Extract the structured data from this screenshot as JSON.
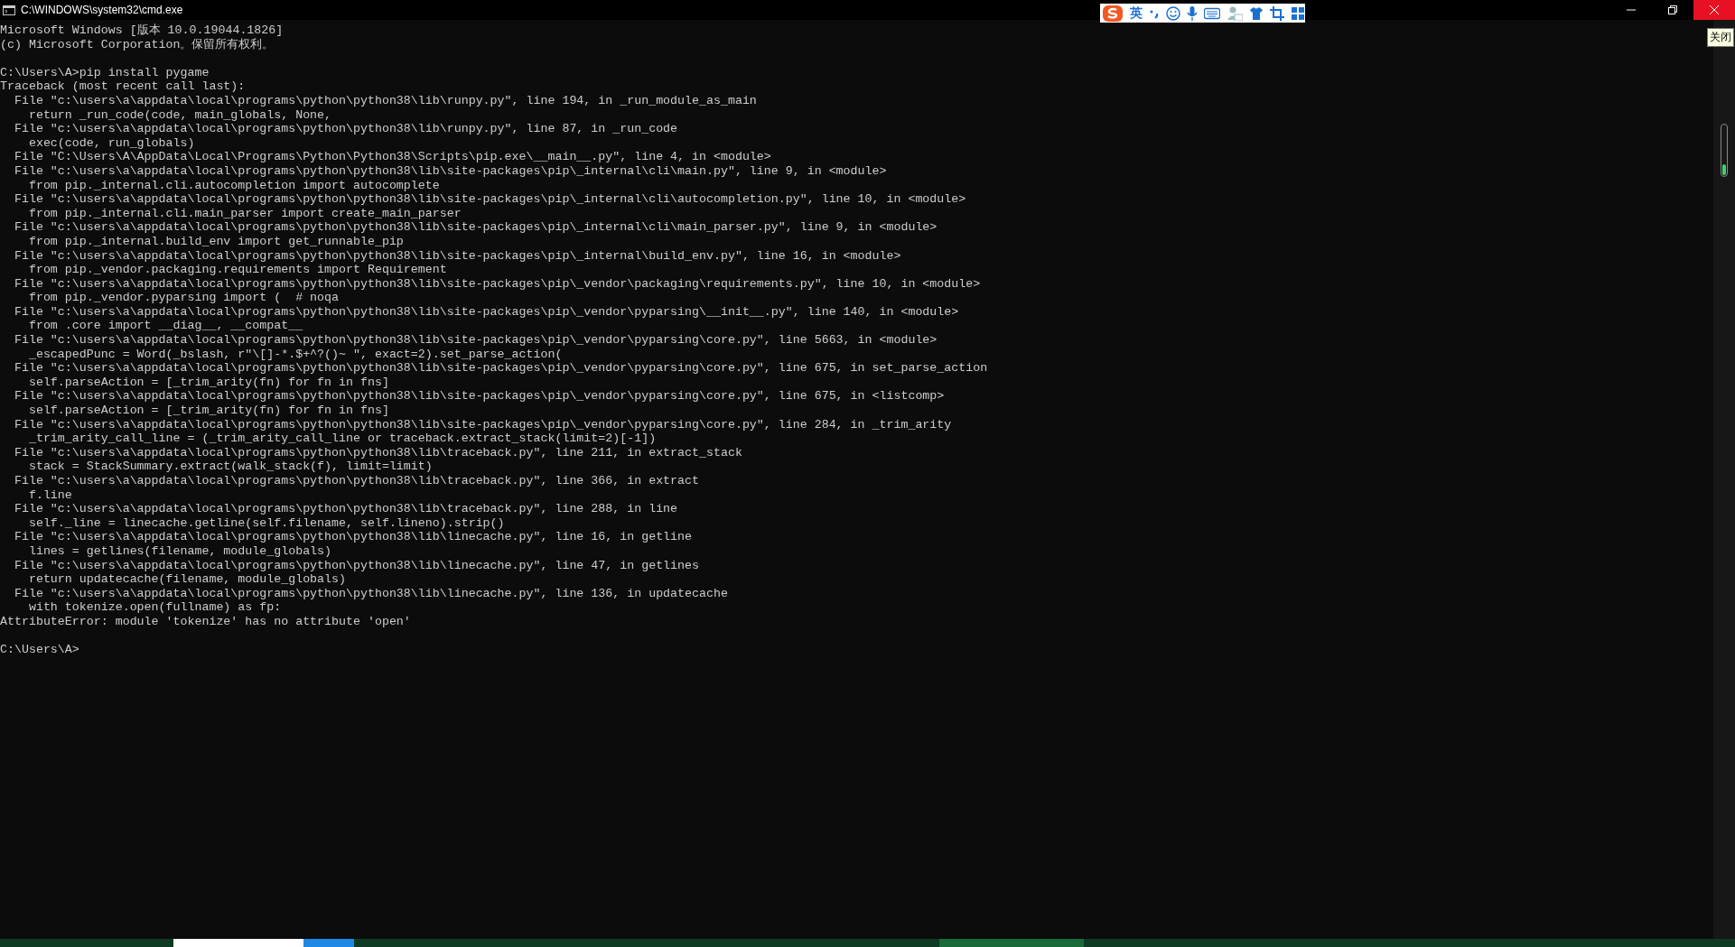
{
  "window": {
    "title": "C:\\WINDOWS\\system32\\cmd.exe"
  },
  "ime_toolbar": {
    "mode": "英"
  },
  "tooltip": "关闭",
  "console": {
    "blocks": [
      [
        "Microsoft Windows [版本 10.0.19044.1826]",
        "(c) Microsoft Corporation。保留所有权利。"
      ],
      [
        "C:\\Users\\A>pip install pygame",
        "Traceback (most recent call last):",
        "  File \"c:\\users\\a\\appdata\\local\\programs\\python\\python38\\lib\\runpy.py\", line 194, in _run_module_as_main",
        "    return _run_code(code, main_globals, None,",
        "  File \"c:\\users\\a\\appdata\\local\\programs\\python\\python38\\lib\\runpy.py\", line 87, in _run_code",
        "    exec(code, run_globals)",
        "  File \"C:\\Users\\A\\AppData\\Local\\Programs\\Python\\Python38\\Scripts\\pip.exe\\__main__.py\", line 4, in <module>",
        "  File \"c:\\users\\a\\appdata\\local\\programs\\python\\python38\\lib\\site-packages\\pip\\_internal\\cli\\main.py\", line 9, in <module>",
        "    from pip._internal.cli.autocompletion import autocomplete",
        "  File \"c:\\users\\a\\appdata\\local\\programs\\python\\python38\\lib\\site-packages\\pip\\_internal\\cli\\autocompletion.py\", line 10, in <module>",
        "    from pip._internal.cli.main_parser import create_main_parser",
        "  File \"c:\\users\\a\\appdata\\local\\programs\\python\\python38\\lib\\site-packages\\pip\\_internal\\cli\\main_parser.py\", line 9, in <module>",
        "    from pip._internal.build_env import get_runnable_pip",
        "  File \"c:\\users\\a\\appdata\\local\\programs\\python\\python38\\lib\\site-packages\\pip\\_internal\\build_env.py\", line 16, in <module>",
        "    from pip._vendor.packaging.requirements import Requirement",
        "  File \"c:\\users\\a\\appdata\\local\\programs\\python\\python38\\lib\\site-packages\\pip\\_vendor\\packaging\\requirements.py\", line 10, in <module>",
        "    from pip._vendor.pyparsing import (  # noqa",
        "  File \"c:\\users\\a\\appdata\\local\\programs\\python\\python38\\lib\\site-packages\\pip\\_vendor\\pyparsing\\__init__.py\", line 140, in <module>",
        "    from .core import __diag__, __compat__",
        "  File \"c:\\users\\a\\appdata\\local\\programs\\python\\python38\\lib\\site-packages\\pip\\_vendor\\pyparsing\\core.py\", line 5663, in <module>",
        "    _escapedPunc = Word(_bslash, r\"\\[]-*.$+^?()~ \", exact=2).set_parse_action(",
        "  File \"c:\\users\\a\\appdata\\local\\programs\\python\\python38\\lib\\site-packages\\pip\\_vendor\\pyparsing\\core.py\", line 675, in set_parse_action",
        "    self.parseAction = [_trim_arity(fn) for fn in fns]",
        "  File \"c:\\users\\a\\appdata\\local\\programs\\python\\python38\\lib\\site-packages\\pip\\_vendor\\pyparsing\\core.py\", line 675, in <listcomp>",
        "    self.parseAction = [_trim_arity(fn) for fn in fns]",
        "  File \"c:\\users\\a\\appdata\\local\\programs\\python\\python38\\lib\\site-packages\\pip\\_vendor\\pyparsing\\core.py\", line 284, in _trim_arity",
        "    _trim_arity_call_line = (_trim_arity_call_line or traceback.extract_stack(limit=2)[-1])",
        "  File \"c:\\users\\a\\appdata\\local\\programs\\python\\python38\\lib\\traceback.py\", line 211, in extract_stack",
        "    stack = StackSummary.extract(walk_stack(f), limit=limit)",
        "  File \"c:\\users\\a\\appdata\\local\\programs\\python\\python38\\lib\\traceback.py\", line 366, in extract",
        "    f.line",
        "  File \"c:\\users\\a\\appdata\\local\\programs\\python\\python38\\lib\\traceback.py\", line 288, in line",
        "    self._line = linecache.getline(self.filename, self.lineno).strip()",
        "  File \"c:\\users\\a\\appdata\\local\\programs\\python\\python38\\lib\\linecache.py\", line 16, in getline",
        "    lines = getlines(filename, module_globals)",
        "  File \"c:\\users\\a\\appdata\\local\\programs\\python\\python38\\lib\\linecache.py\", line 47, in getlines",
        "    return updatecache(filename, module_globals)",
        "  File \"c:\\users\\a\\appdata\\local\\programs\\python\\python38\\lib\\linecache.py\", line 136, in updatecache",
        "    with tokenize.open(fullname) as fp:",
        "AttributeError: module 'tokenize' has no attribute 'open'"
      ],
      [
        "C:\\Users\\A>"
      ]
    ]
  }
}
